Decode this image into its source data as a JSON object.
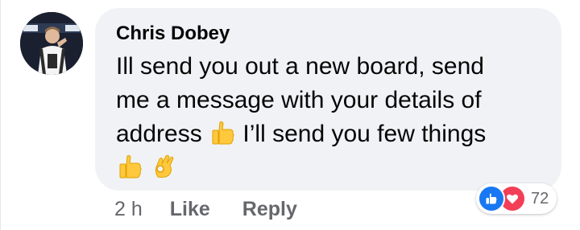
{
  "comment": {
    "author": "Chris Dobey",
    "lines": [
      "Ill send you out a new board, send",
      "me a message with your details of",
      "address",
      "I’ll send you few things"
    ],
    "inline_emoji": "thumbs-up-icon",
    "trailing_emojis": [
      "thumbs-up-icon",
      "ok-hand-icon"
    ]
  },
  "actions": {
    "time": "2 h",
    "like_label": "Like",
    "reply_label": "Reply"
  },
  "reactions": {
    "icons": [
      "like-icon",
      "love-icon"
    ],
    "count": "72"
  },
  "colors": {
    "bubble": "#f0f2f5",
    "text": "#050505",
    "secondary": "#65676b",
    "like": "#1877f2",
    "love": "#f33e58",
    "emoji": "#ffc83d"
  }
}
